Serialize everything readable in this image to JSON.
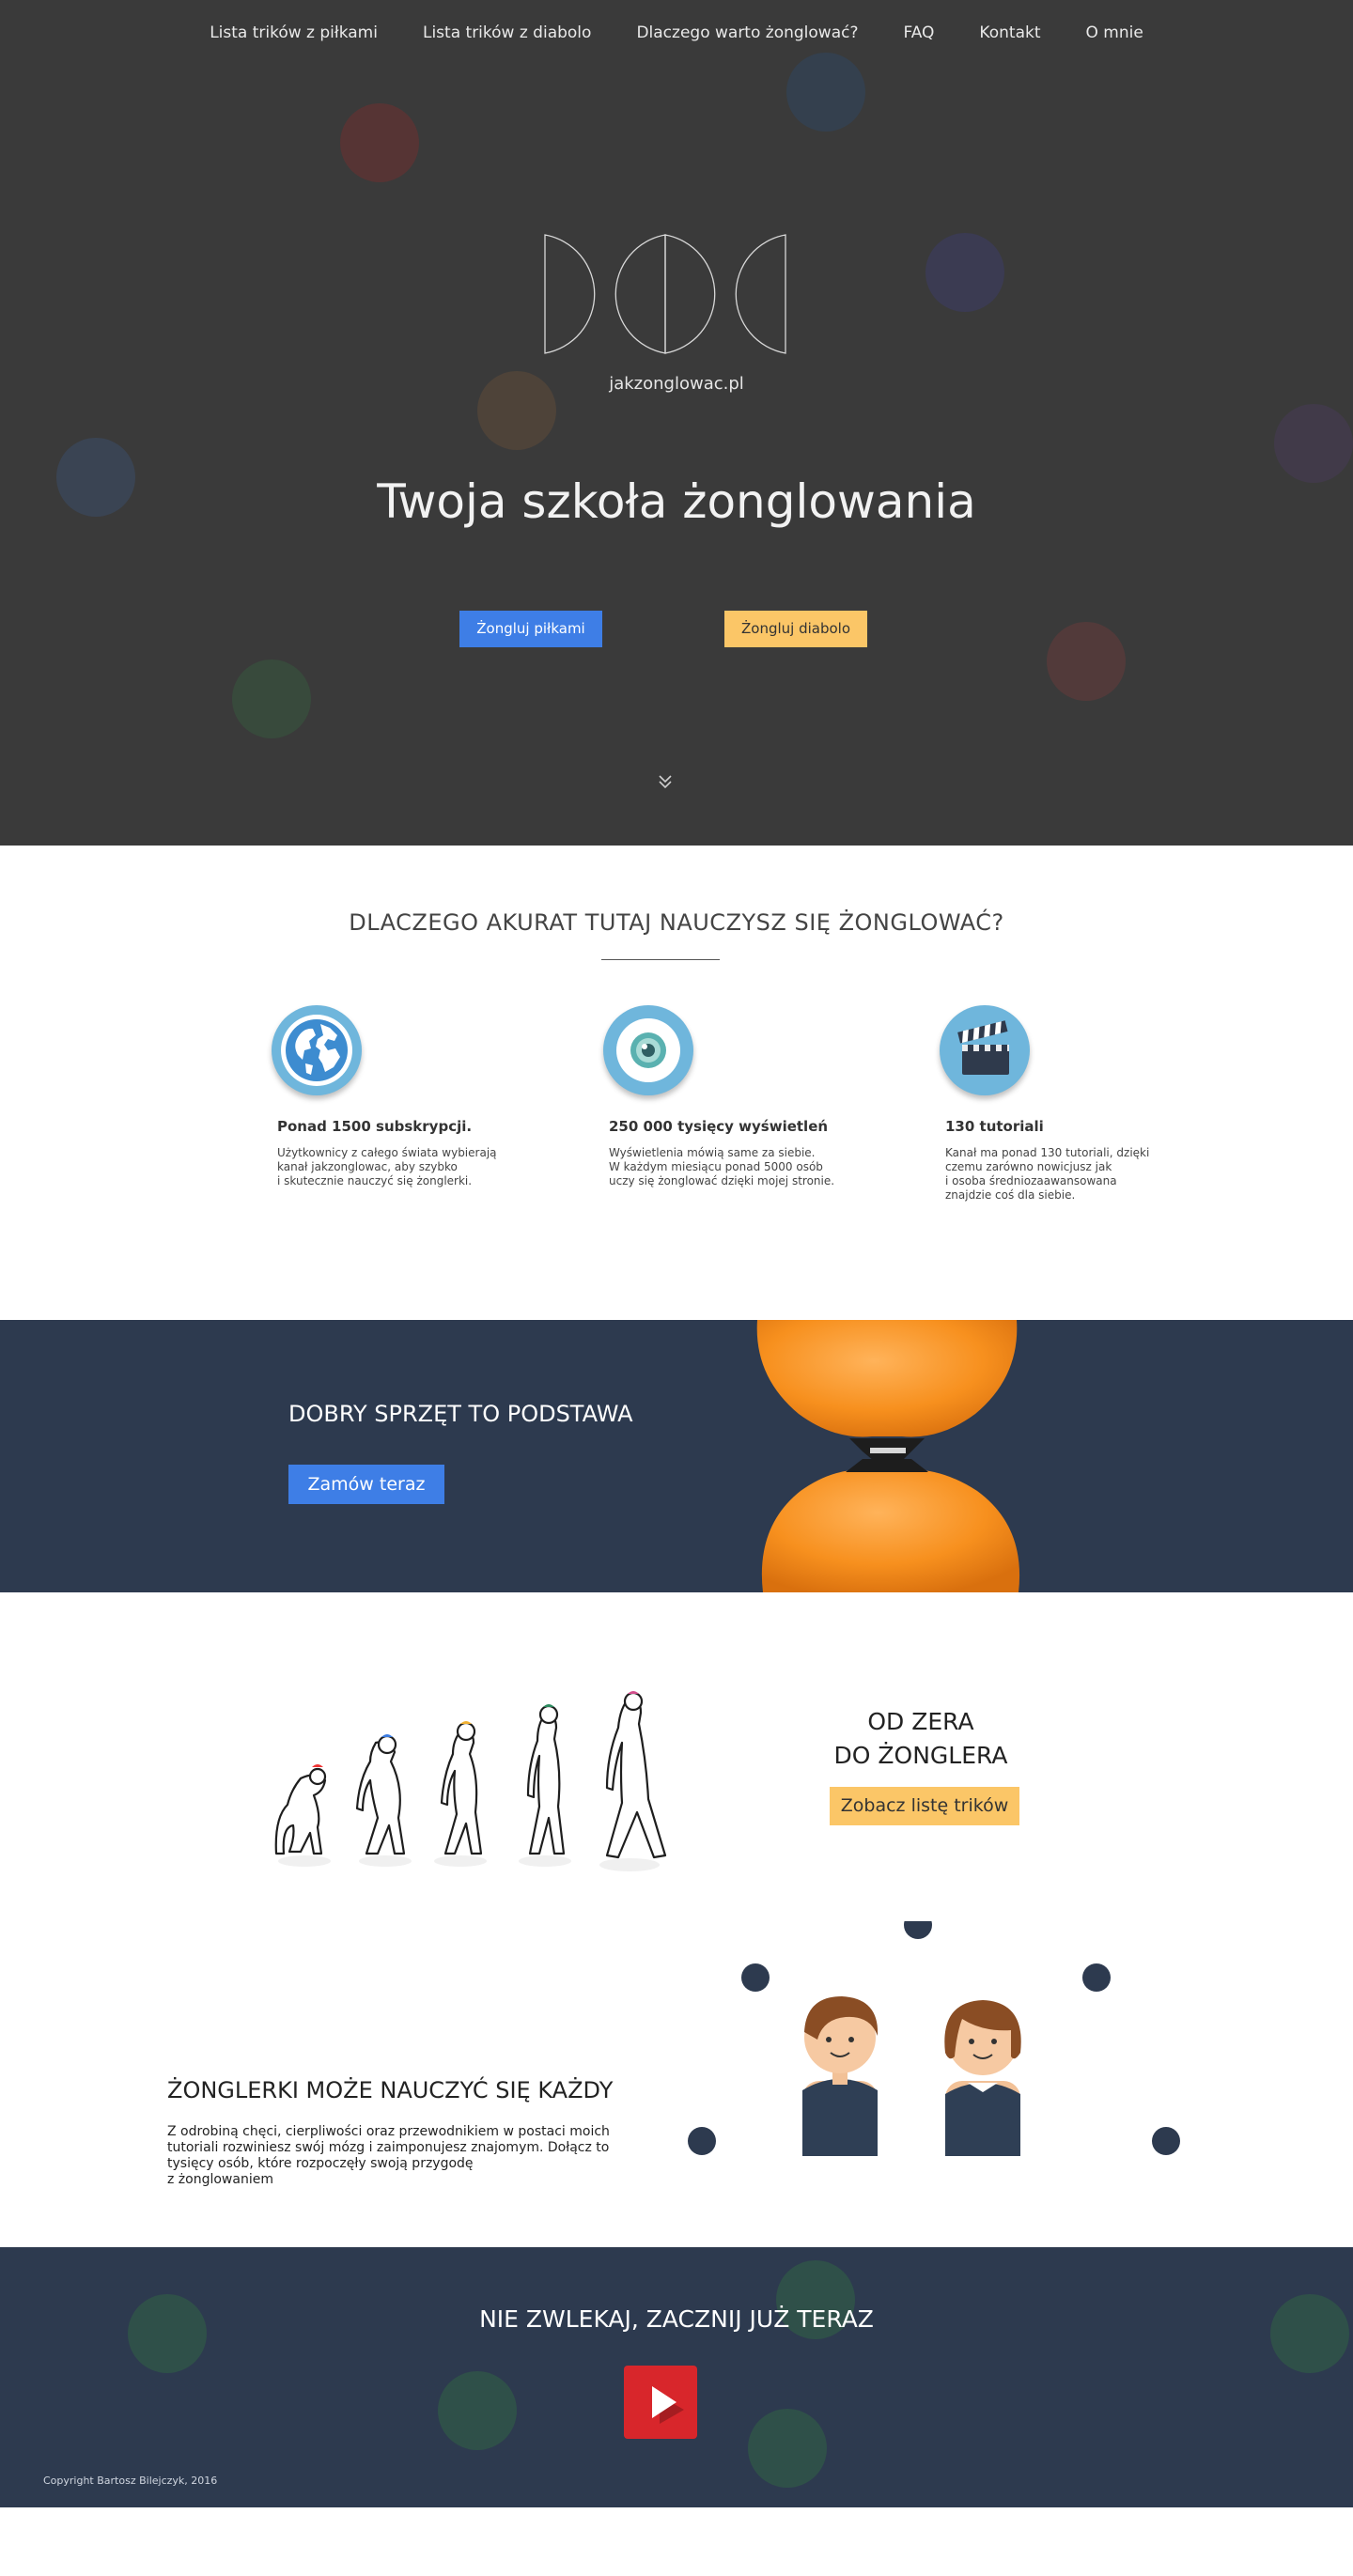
{
  "nav": {
    "items": [
      {
        "label": "Lista trików z piłkami"
      },
      {
        "label": "Lista trików z diabolo"
      },
      {
        "label": "Dlaczego warto żonglować?"
      },
      {
        "label": "FAQ"
      },
      {
        "label": "Kontakt"
      },
      {
        "label": "O mnie"
      }
    ]
  },
  "hero": {
    "logo_text": "jakzonglowac.pl",
    "title": "Twoja szkoła żonglowania",
    "btn_balls": "Żongluj piłkami",
    "btn_diabolo": "Żongluj diabolo",
    "scroll_icon": "double-chevron-down-icon",
    "bg_color": "#3a3a3a"
  },
  "why": {
    "title": "DLACZEGO AKURAT TUTAJ NAUCZYSZ SIĘ ŻONGLOWAĆ?",
    "features": [
      {
        "icon": "globe-icon",
        "title": "Ponad 1500 subskrypcji.",
        "text": "Użytkownicy z całego świata wybierają\nkanał jakzonglowac, aby szybko\ni skutecznie nauczyć się żonglerki."
      },
      {
        "icon": "eye-icon",
        "title": "250 000 tysięcy wyświetleń",
        "text": "Wyświetlenia mówią same za siebie.\nW każdym miesiącu ponad 5000 osób\nuczy się żonglować dzięki mojej stronie."
      },
      {
        "icon": "clapperboard-icon",
        "title": "130 tutoriali",
        "text": "Kanał ma ponad 130 tutoriali, dzięki\nczemu zarówno nowicjusz jak\ni osoba średniozaawansowana\nznajdzie coś dla siebie."
      }
    ]
  },
  "gear": {
    "title": "DOBRY SPRZĘT TO PODSTAWA",
    "button": "Zamów teraz",
    "bg_color": "#2d3a4f"
  },
  "zero": {
    "title_line1": "OD ZERA",
    "title_line2": "DO ŻONGLERA",
    "button": "Zobacz listę trików"
  },
  "everyone": {
    "title": "ŻONGLERKI MOŻE NAUCZYĆ SIĘ KAŻDY",
    "text": "Z odrobiną chęci, cierpliwości oraz przewodnikiem w postaci moich\ntutoriali rozwiniesz swój mózg i zaimponujesz znajomym. Dołącz to\ntysięcy osób, które rozpoczęły swoją przygodę\nz żonglowaniem"
  },
  "footer": {
    "title": "NIE ZWLEKAJ, ZACZNIJ JUŻ TERAZ",
    "play_icon": "youtube-play-icon",
    "copyright": "Copyright Bartosz Bilejczyk, 2016"
  },
  "colors": {
    "accent_blue": "#3e7ee6",
    "accent_yellow": "#fbc667",
    "navy": "#2d3a4f",
    "youtube_red": "#d8262b"
  }
}
